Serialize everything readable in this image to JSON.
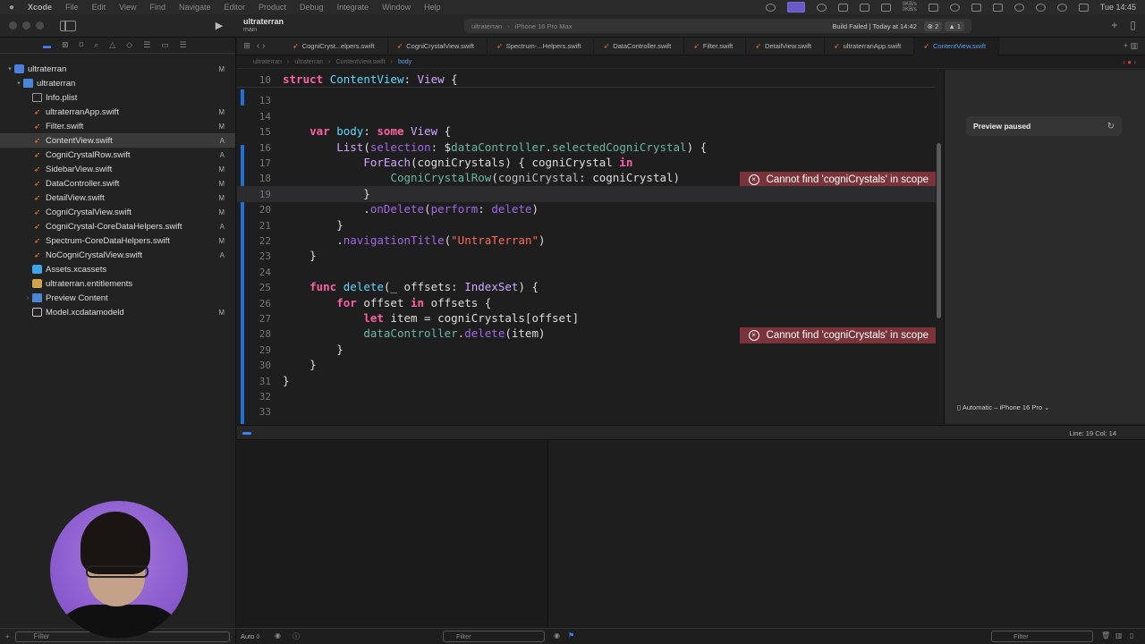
{
  "menubar": {
    "items": [
      "Xcode",
      "File",
      "Edit",
      "View",
      "Find",
      "Navigate",
      "Editor",
      "Product",
      "Debug",
      "Integrate",
      "Window",
      "Help"
    ],
    "net_up": "0KB/s",
    "net_down": "0KB/s",
    "clock": "Tue 14:45"
  },
  "toolbar": {
    "project": "ultraterran",
    "branch": "main",
    "destination_app": "ultraterran",
    "destination_device": "iPhone 16 Pro Max",
    "build_status": "Build Failed | Today at 14:42",
    "error_badge": "2",
    "warning_badge": "1"
  },
  "navigator": {
    "filter_placeholder": "Filter",
    "items": [
      {
        "label": "ultraterran",
        "status": "M",
        "kind": "proj",
        "depth": 0,
        "disclosure": "▾"
      },
      {
        "label": "ultraterran",
        "status": "",
        "kind": "folder",
        "depth": 1,
        "disclosure": "▾"
      },
      {
        "label": "Info.plist",
        "status": "",
        "kind": "plist",
        "depth": 2,
        "disclosure": ""
      },
      {
        "label": "ultraterranApp.swift",
        "status": "M",
        "kind": "swift",
        "depth": 2,
        "disclosure": ""
      },
      {
        "label": "Filter.swift",
        "status": "M",
        "kind": "swift",
        "depth": 2,
        "disclosure": ""
      },
      {
        "label": "ContentView.swift",
        "status": "A",
        "kind": "swift",
        "depth": 2,
        "disclosure": "",
        "selected": true
      },
      {
        "label": "CogniCrystalRow.swift",
        "status": "A",
        "kind": "swift",
        "depth": 2,
        "disclosure": ""
      },
      {
        "label": "SidebarView.swift",
        "status": "M",
        "kind": "swift",
        "depth": 2,
        "disclosure": ""
      },
      {
        "label": "DataController.swift",
        "status": "M",
        "kind": "swift",
        "depth": 2,
        "disclosure": ""
      },
      {
        "label": "DetailView.swift",
        "status": "M",
        "kind": "swift",
        "depth": 2,
        "disclosure": ""
      },
      {
        "label": "CogniCrystalView.swift",
        "status": "M",
        "kind": "swift",
        "depth": 2,
        "disclosure": ""
      },
      {
        "label": "CogniCrystal-CoreDataHelpers.swift",
        "status": "A",
        "kind": "swift",
        "depth": 2,
        "disclosure": ""
      },
      {
        "label": "Spectrum-CoreDataHelpers.swift",
        "status": "M",
        "kind": "swift",
        "depth": 2,
        "disclosure": ""
      },
      {
        "label": "NoCogniCrystalView.swift",
        "status": "A",
        "kind": "swift",
        "depth": 2,
        "disclosure": ""
      },
      {
        "label": "Assets.xcassets",
        "status": "",
        "kind": "assets",
        "depth": 2,
        "disclosure": ""
      },
      {
        "label": "ultraterran.entitlements",
        "status": "",
        "kind": "ent",
        "depth": 2,
        "disclosure": ""
      },
      {
        "label": "Preview Content",
        "status": "",
        "kind": "folder",
        "depth": 2,
        "disclosure": "›"
      },
      {
        "label": "Model.xcdatamodeld",
        "status": "M",
        "kind": "model",
        "depth": 2,
        "disclosure": ""
      }
    ]
  },
  "tabs": [
    {
      "label": "CogniCryst...elpers.swift",
      "active": false
    },
    {
      "label": "CogniCrystalView.swift",
      "active": false
    },
    {
      "label": "Spectrum-...Helpers.swift",
      "active": false
    },
    {
      "label": "DataController.swift",
      "active": false
    },
    {
      "label": "Filter.swift",
      "active": false
    },
    {
      "label": "DetailView.swift",
      "active": false
    },
    {
      "label": "ultraterranApp.swift",
      "active": false
    },
    {
      "label": "ContentView.swift",
      "active": true
    }
  ],
  "breadcrumb": [
    "ultraterran",
    "ultraterran",
    "ContentView.swift",
    "body"
  ],
  "editor": {
    "lines": [
      {
        "n": "10",
        "html": "<span class='kw'>struct</span> <span class='ty'>ContentView</span>: <span class='tyb'>View</span> {",
        "top": true
      },
      {
        "n": "13",
        "html": ""
      },
      {
        "n": "14",
        "html": ""
      },
      {
        "n": "15",
        "html": "    <span class='kw'>var</span> <span class='ty'>body</span>: <span class='kw'>some</span> <span class='tyb'>View</span> {"
      },
      {
        "n": "16",
        "html": "        <span class='tyb'>List</span>(<span class='pm'>selection</span>: $<span class='fn'>dataController</span>.<span class='fn'>selectedCogniCrystal</span>) {"
      },
      {
        "n": "17",
        "html": "            <span class='tyb'>ForEach</span>(cogniCrystals) { cogniCrystal <span class='kw'>in</span>"
      },
      {
        "n": "18",
        "html": "                <span class='fn'>CogniCrystalRow</span>(<span class='lbl'>cogniCrystal</span>: cogniCrystal)"
      },
      {
        "n": "19",
        "html": "            }",
        "current": true
      },
      {
        "n": "20",
        "html": "            .<span class='pm'>onDelete</span>(<span class='pm'>perform</span>: <span class='pm'>delete</span>)"
      },
      {
        "n": "21",
        "html": "        }"
      },
      {
        "n": "22",
        "html": "        .<span class='pm'>navigationTitle</span>(<span class='str'>\"UntraTerran\"</span>)"
      },
      {
        "n": "23",
        "html": "    }"
      },
      {
        "n": "24",
        "html": ""
      },
      {
        "n": "25",
        "html": "    <span class='kw'>func</span> <span class='ty'>delete</span>(_ offsets: <span class='tyb'>IndexSet</span>) {"
      },
      {
        "n": "26",
        "html": "        <span class='kw'>for</span> offset <span class='kw'>in</span> offsets {"
      },
      {
        "n": "27",
        "html": "            <span class='kw'>let</span> item = cogniCrystals[offset]"
      },
      {
        "n": "28",
        "html": "            <span class='fn'>dataController</span>.<span class='pm'>delete</span>(item)"
      },
      {
        "n": "29",
        "html": "        }"
      },
      {
        "n": "30",
        "html": "    }"
      },
      {
        "n": "31",
        "html": "}"
      },
      {
        "n": "32",
        "html": ""
      },
      {
        "n": "33",
        "html": ""
      }
    ],
    "errors": [
      {
        "line": "17",
        "message": "Cannot find 'cogniCrystals' in scope"
      },
      {
        "line": "27",
        "message": "Cannot find 'cogniCrystals' in scope"
      }
    ]
  },
  "canvas": {
    "status": "Preview paused",
    "device": "Automatic – iPhone 16 Pro"
  },
  "statusbar": {
    "position": "Line: 19  Col: 14"
  },
  "debug": {
    "auto_label": "Auto ◊",
    "filter_left": "Filter",
    "filter_right": "Filter"
  }
}
